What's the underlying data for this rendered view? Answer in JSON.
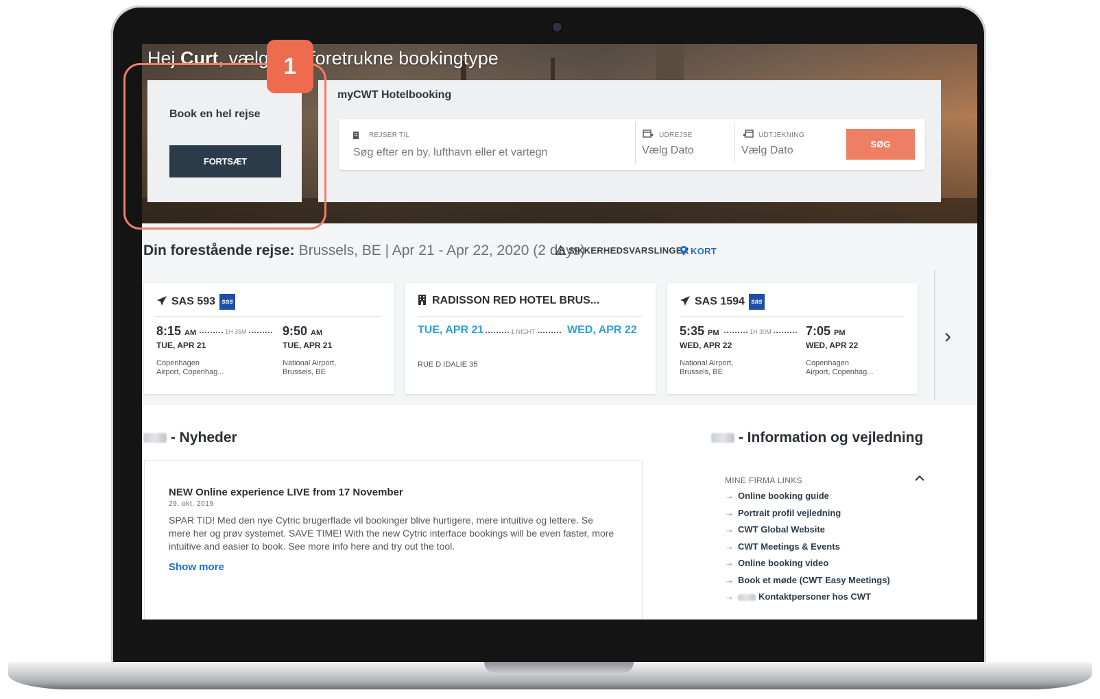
{
  "hero": {
    "title_prefix": "Hej ",
    "user_name": "Curt",
    "title_suffix": ", vælg den foretrukne bookingtype"
  },
  "booking_options": {
    "full_trip": {
      "title": "Book en hel rejse",
      "button_label": "FORTSÆT"
    },
    "hotel": {
      "title": "myCWT Hotelbooking",
      "destination_label": "REJSER TIL",
      "destination_placeholder": "Søg efter en by, lufthavn eller et vartegn",
      "checkin_label": "UDREJSE",
      "checkin_placeholder": "Vælg Dato",
      "checkout_label": "UDTJEKNING",
      "checkout_placeholder": "Vælg Dato",
      "search_button": "SØG"
    }
  },
  "upcoming_trip": {
    "label": "Din forestående rejse:",
    "details": "Brussels, BE | Apr 21 - Apr 22, 2020 (2 days)",
    "alerts_label": "SIKKERHEDSVARSLINGER",
    "map_label": "KORT",
    "segments": [
      {
        "type": "flight",
        "title": "SAS 593",
        "airline_badge": "sas",
        "depart_time": "8:15",
        "depart_ampm": "AM",
        "depart_date": "TUE, APR 21",
        "duration": "1H 35M",
        "arrive_time": "9:50",
        "arrive_ampm": "AM",
        "arrive_date": "TUE, APR 21",
        "from_line1": "Copenhagen",
        "from_line2": "Airport, Copenhag...",
        "to_line1": "National Airport,",
        "to_line2": "Brussels, BE"
      },
      {
        "type": "hotel",
        "title": "RADISSON RED HOTEL BRUS...",
        "checkin_date": "TUE, APR 21",
        "nights": "1 NIGHT",
        "checkout_date": "WED, APR 22",
        "address": "RUE D IDALIE 35"
      },
      {
        "type": "flight",
        "title": "SAS 1594",
        "airline_badge": "sas",
        "depart_time": "5:35",
        "depart_ampm": "PM",
        "depart_date": "WED, APR 22",
        "duration": "1H 30M",
        "arrive_time": "7:05",
        "arrive_ampm": "PM",
        "arrive_date": "WED, APR 22",
        "from_line1": "National Airport,",
        "from_line2": "Brussels, BE",
        "to_line1": "Copenhagen",
        "to_line2": "Airport, Copenhag..."
      }
    ]
  },
  "news": {
    "heading": "- Nyheder",
    "item": {
      "title": "NEW Online experience LIVE from 17 November",
      "date": "29. okt. 2019",
      "body": "SPAR TID! Med den nye Cytric brugerflade vil bookinger blive hurtigere, mere intuitive og lettere. Se mere her og prøv systemet.    SAVE TIME! With the new Cytric interface bookings will be even faster, more intuitive and easier to book. See more info here and try out the tool.",
      "show_more": "Show more"
    }
  },
  "info": {
    "heading": "- Information og vejledning",
    "links_label": "MINE FIRMA LINKS",
    "links": [
      "Online booking guide",
      "Portrait profil vejledning",
      "CWT Global Website",
      "CWT Meetings & Events",
      "Online booking video",
      "Book et møde (CWT Easy Meetings)",
      "Kontaktpersoner hos CWT"
    ]
  },
  "annotation": {
    "step_number": "1"
  },
  "colors": {
    "accent": "#ef7f64",
    "dark_button": "#2b3b49",
    "link_blue": "#1d6fc8",
    "hotel_date_blue": "#2aa0d9",
    "sas_blue": "#1d4fa8",
    "arrow_red": "#ea5a3b"
  },
  "icons": [
    "building-icon",
    "calendar-icon",
    "warning-icon",
    "map-pin-icon",
    "plane-icon",
    "hotel-icon",
    "chevron-right-icon",
    "chevron-up-icon",
    "arrow-right-icon"
  ]
}
